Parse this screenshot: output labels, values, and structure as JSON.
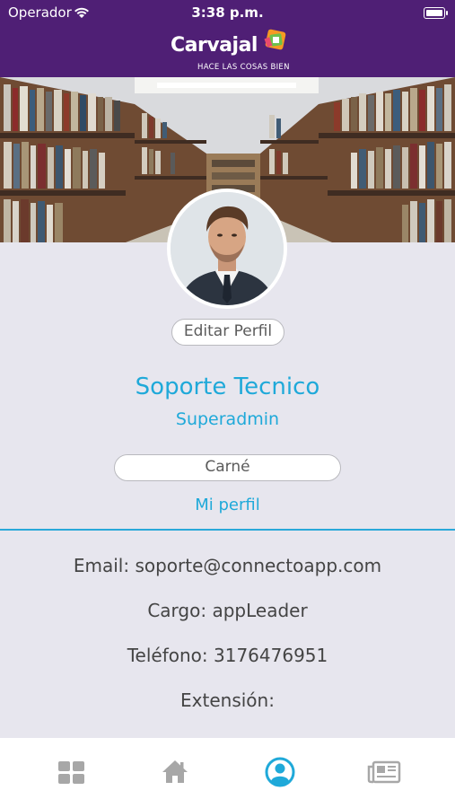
{
  "status_bar": {
    "carrier": "Operador",
    "time": "3:38 p.m."
  },
  "logo": {
    "name": "Carvajal",
    "tagline": "HACE LAS COSAS BIEN"
  },
  "profile": {
    "edit_label": "Editar Perfil",
    "name": "Soporte Tecnico",
    "role": "Superadmin",
    "carne_label": "Carné",
    "my_profile_link": "Mi perfil"
  },
  "info": {
    "email": "Email: soporte@connectoapp.com",
    "cargo": "Cargo: appLeader",
    "telefono": "Teléfono: 3176476951",
    "extension": "Extensión:"
  },
  "tabbar": {
    "tabs": [
      {
        "icon": "grid-icon",
        "active": false
      },
      {
        "icon": "home-icon",
        "active": false
      },
      {
        "icon": "profile-icon",
        "active": true
      },
      {
        "icon": "news-icon",
        "active": false
      }
    ]
  },
  "colors": {
    "header": "#4f1f75",
    "accent": "#1fa9d9",
    "background": "#e7e6ee",
    "inactive_icon": "#a7a7a7"
  }
}
